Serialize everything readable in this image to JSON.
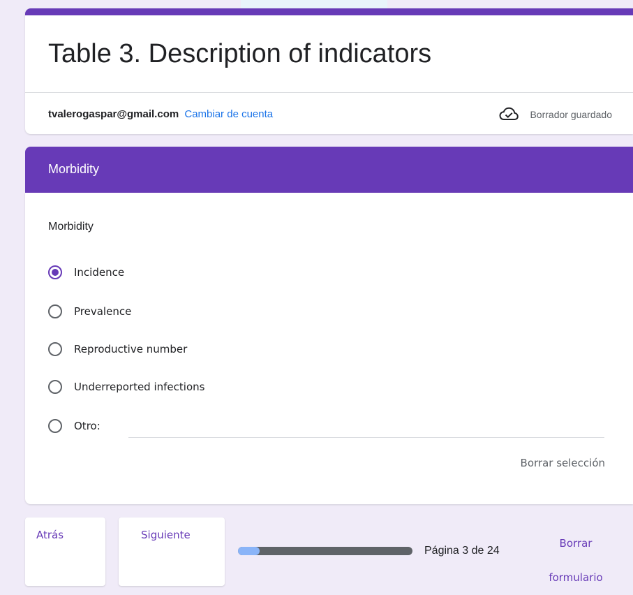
{
  "form": {
    "title": "Table 3. Description of indicators",
    "account_email": "tvalerogaspar@gmail.com",
    "switch_account_label": "Cambiar de cuenta",
    "draft_status": "Borrador guardado",
    "draft_icon": "cloud-check-icon"
  },
  "section": {
    "title": "Morbidity"
  },
  "question": {
    "title": "Morbidity",
    "options": [
      {
        "label": "Incidence",
        "selected": true
      },
      {
        "label": "Prevalence",
        "selected": false
      },
      {
        "label": "Reproductive number",
        "selected": false
      },
      {
        "label": "Underreported infections",
        "selected": false
      },
      {
        "label": "Otro:",
        "selected": false
      }
    ],
    "clear_selection_label": "Borrar selección"
  },
  "footer": {
    "back_label": "Atrás",
    "next_label": "Siguiente",
    "progress_fraction": 0.125,
    "page_indicator": "Página 3 de 24",
    "clear_form_label_line1": "Borrar",
    "clear_form_label_line2": "formulario"
  },
  "colors": {
    "accent": "#673ab7",
    "link": "#1a73e8",
    "background": "#f0ebf8",
    "progress_fill": "#8ab4f8",
    "progress_track": "#5f6368"
  }
}
